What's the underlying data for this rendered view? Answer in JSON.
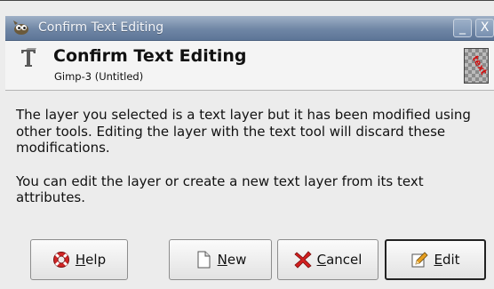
{
  "window": {
    "title": "Confirm Text Editing",
    "minimize_label": "_",
    "close_label": "X"
  },
  "header": {
    "title": "Confirm Text Editing",
    "subtitle": "Gimp-3 (Untitled)"
  },
  "message": {
    "paragraph1": "The layer you selected is a text layer but it has been modified using other tools. Editing the layer with the text tool will discard these modifications.",
    "paragraph2": "You can edit the layer or create a new text layer from its text attributes."
  },
  "buttons": {
    "help": {
      "mnemonic": "H",
      "rest": "elp",
      "icon": "lifebuoy-icon"
    },
    "new": {
      "mnemonic": "N",
      "rest": "ew",
      "icon": "new-document-icon"
    },
    "cancel": {
      "mnemonic": "C",
      "rest": "ancel",
      "icon": "cancel-x-icon"
    },
    "edit": {
      "mnemonic": "E",
      "rest": "dit",
      "icon": "edit-pencil-icon"
    }
  },
  "colors": {
    "titlebar": "#6f86a5",
    "dialog_bg": "#ececec",
    "cancel_icon": "#d22020",
    "help_icon": "#d02525"
  }
}
